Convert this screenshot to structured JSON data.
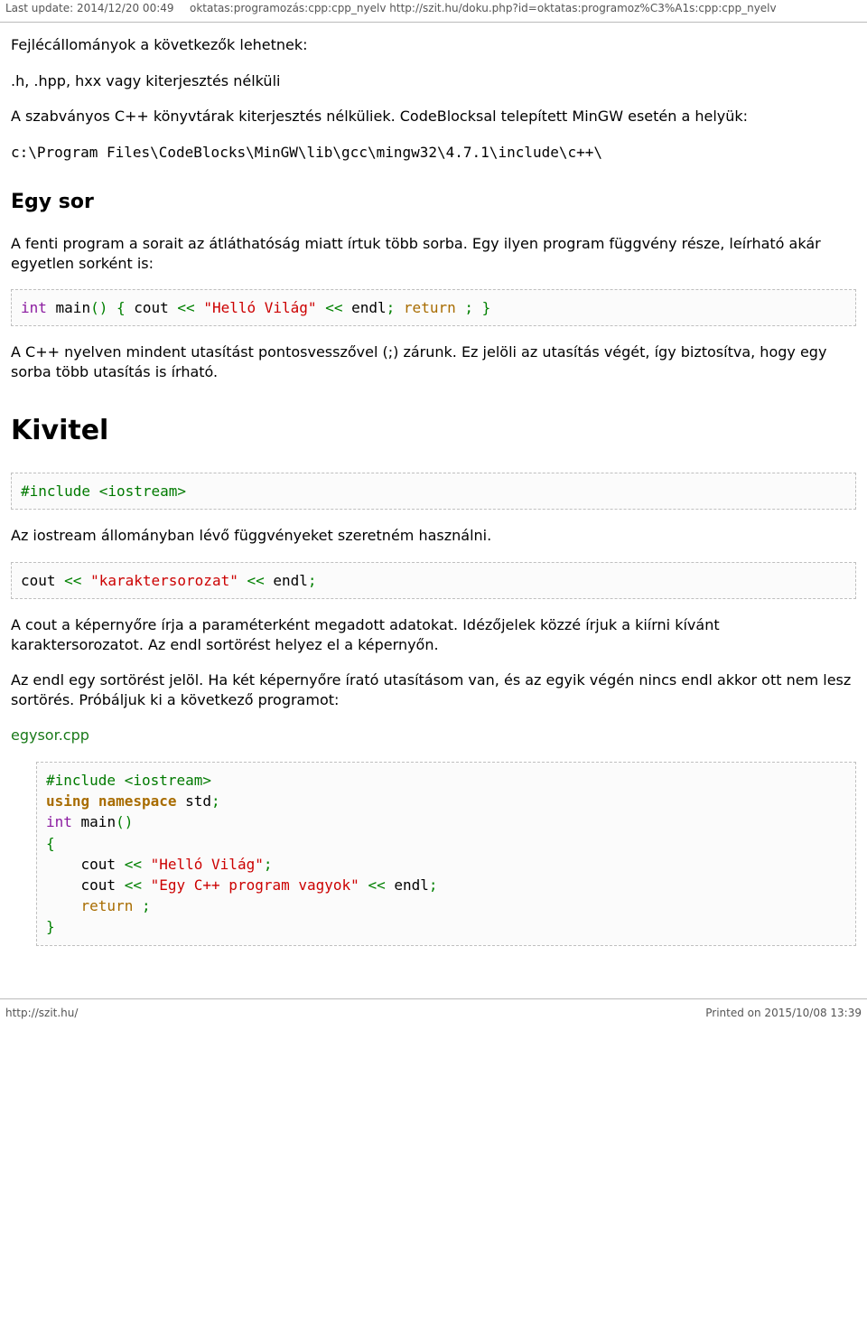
{
  "header": {
    "last_update": "Last update: 2014/12/20 00:49",
    "path": "oktatas:programozás:cpp:cpp_nyelv http://szit.hu/doku.php?id=oktatas:programoz%C3%A1s:cpp:cpp_nyelv"
  },
  "body": {
    "p1": "Fejlécállományok a következők lehetnek:",
    "p2": ".h, .hpp, hxx vagy kiterjesztés nélküli",
    "p3": "A szabványos C++ könyvtárak kiterjesztés nélküliek. CodeBlocksal telepített MinGW esetén a helyük:",
    "code1": "c:\\Program Files\\CodeBlocks\\MinGW\\lib\\gcc\\mingw32\\4.7.1\\include\\c++\\",
    "h2_egysor": "Egy sor",
    "p4": "A fenti program a sorait az átláthatóság miatt írtuk több sorba. Egy ilyen program függvény része, leírható akár egyetlen sorként is:",
    "code2": {
      "int": "int",
      "main": " main",
      "parens": "()",
      "sp1": " ",
      "lbrace": "{",
      "sp2": " cout ",
      "op1": "<<",
      "sp3": " ",
      "str": "\"Helló Világ\"",
      "sp4": " ",
      "op2": "<<",
      "sp5": " endl",
      "semi1": ";",
      "sp6": " ",
      "ret": "return",
      "sp7": " ",
      "semi2": ";",
      "sp8": " ",
      "rbrace": "}"
    },
    "p5": "A C++ nyelven mindent utasítást pontosvesszővel (;) zárunk. Ez jelöli az utasítás végét, így biztosítva, hogy egy sorba több utasítás is írható.",
    "h1_kivitel": "Kivitel",
    "code3": {
      "inc": "#include <iostream>"
    },
    "p6": "Az iostream állományban lévő függvényeket szeretném használni.",
    "code4": {
      "cout": "cout ",
      "op1": "<<",
      "sp1": " ",
      "str": "\"karaktersorozat\"",
      "sp2": " ",
      "op2": "<<",
      "sp3": " endl",
      "semi": ";"
    },
    "p7": "A cout a képernyőre írja a paraméterként megadott adatokat. Idézőjelek közzé írjuk a kiírni kívánt karaktersorozatot. Az endl sortörést helyez el a képernyőn.",
    "p8": "Az endl egy sortörést jelöl. Ha két képernyőre írató utasításom van, és az egyik végén nincs endl akkor ott nem lesz sortörés. Próbáljuk ki a következő programot:",
    "filelink": "egysor.cpp",
    "code5": {
      "l1_inc": "#include <iostream>",
      "l2_using": "using",
      "l2_sp1": " ",
      "l2_ns": "namespace",
      "l2_sp2": " std",
      "l2_semi": ";",
      "l3_int": "int",
      "l3_main": " main",
      "l3_parens": "()",
      "l4_lbrace": "{",
      "l5_indent": "    cout ",
      "l5_op1": "<<",
      "l5_sp1": " ",
      "l5_str": "\"Helló Világ\"",
      "l5_semi": ";",
      "l6_indent": "    cout ",
      "l6_op1": "<<",
      "l6_sp1": " ",
      "l6_str": "\"Egy C++ program vagyok\"",
      "l6_sp2": " ",
      "l6_op2": "<<",
      "l6_sp3": " endl",
      "l6_semi": ";",
      "l7_indent": "    ",
      "l7_ret": "return",
      "l7_sp": " ",
      "l7_semi": ";",
      "l8_rbrace": "}"
    }
  },
  "footer": {
    "left": "http://szit.hu/",
    "right": "Printed on 2015/10/08 13:39"
  }
}
